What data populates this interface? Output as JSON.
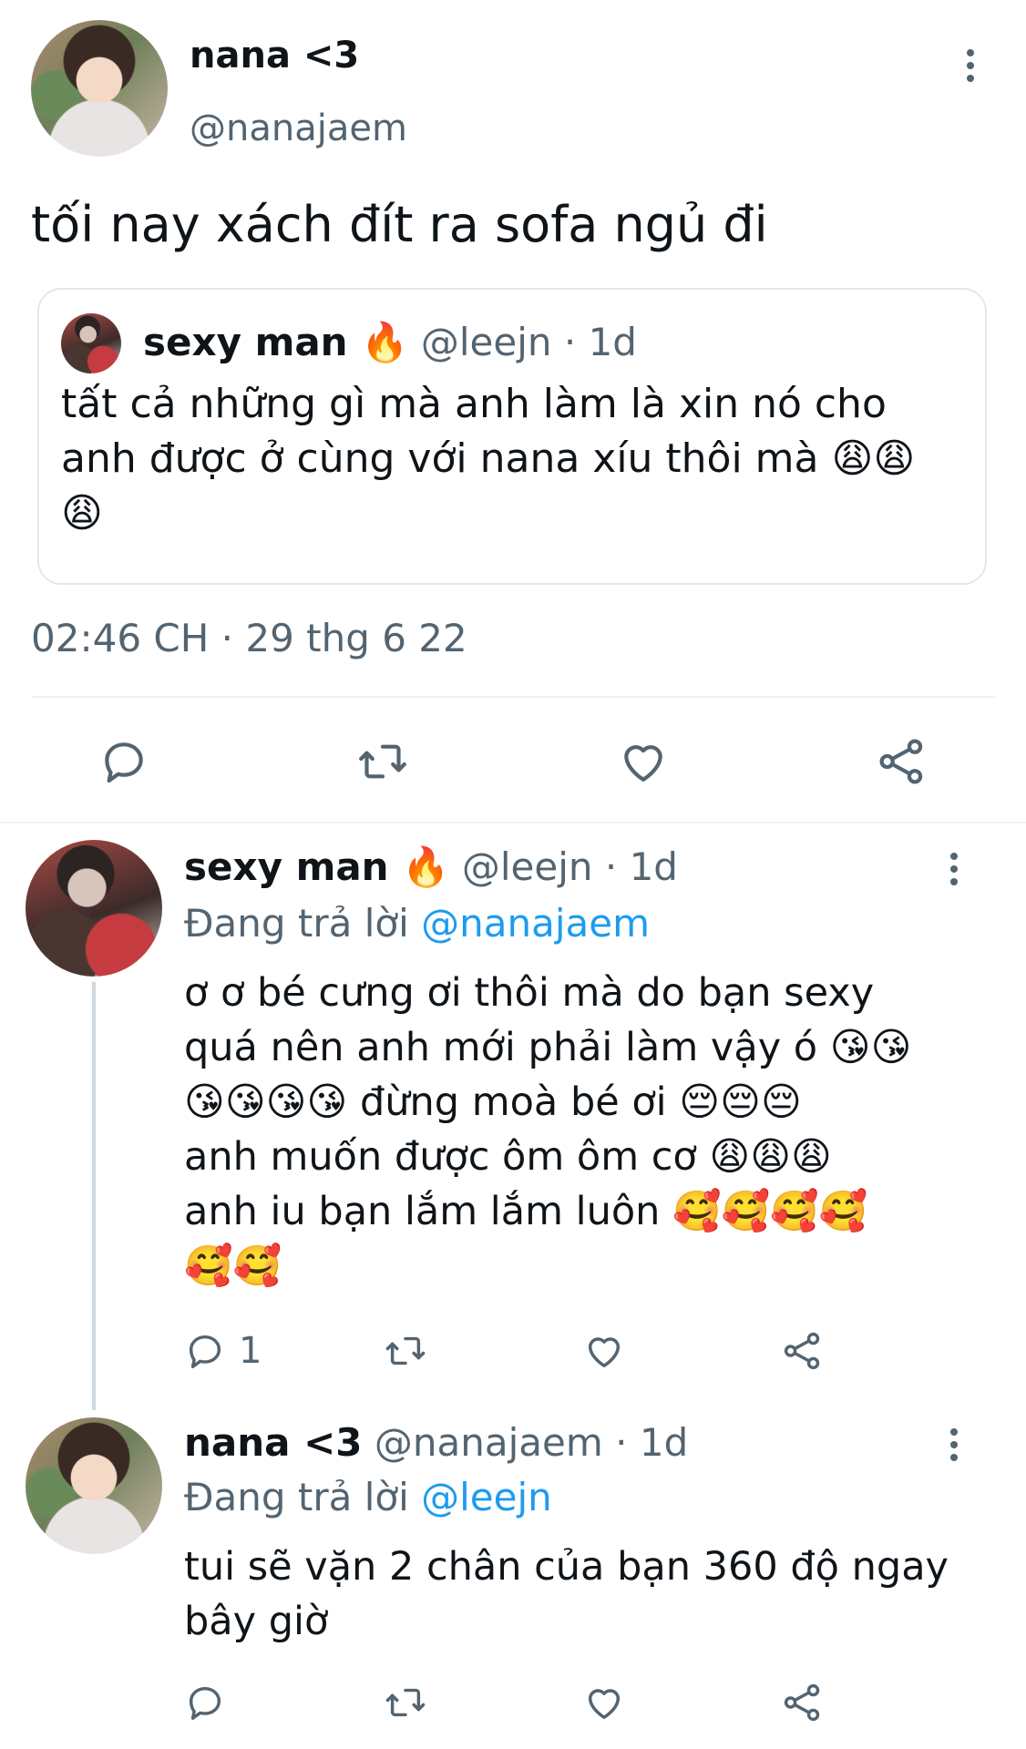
{
  "main_tweet": {
    "display_name": "nana <3",
    "handle": "@nanajaem",
    "text": "tối nay xách đít ra sofa ngủ đi",
    "timestamp": "02:46 CH · 29 thg 6 22",
    "quoted": {
      "display_name": "sexy man 🔥",
      "handle": "@leejn",
      "dot": "·",
      "time": "1d",
      "text_line1": "tất cả những gì mà anh làm là xin nó cho",
      "text_line2": "anh được ở cùng với nana xíu thôi mà 😩😩",
      "text_line3": "😩"
    }
  },
  "reply1": {
    "display_name": "sexy man 🔥",
    "handle": "@leejn",
    "dot": "·",
    "time": "1d",
    "replying_prefix": "Đang trả lời",
    "replying_to": "@nanajaem",
    "lines": [
      "ơ ơ bé cưng ơi thôi mà do bạn sexy",
      "quá nên anh mới phải làm vậy ó 😘😘",
      "😘😘😘😘 đừng moà bé ơi 😔😔😔",
      "anh muốn được ôm ôm cơ 😩😩😩",
      "anh iu bạn lắm lắm luôn 🥰🥰🥰🥰",
      "🥰🥰"
    ],
    "reply_count": "1"
  },
  "reply2": {
    "display_name": "nana <3",
    "handle": "@nanajaem",
    "dot": "·",
    "time": "1d",
    "replying_prefix": "Đang trả lời",
    "replying_to": "@leejn",
    "lines": [
      "tui sẽ vặn 2 chân của bạn 360 độ ngay",
      "bây giờ"
    ]
  },
  "icons": {
    "reply": "reply-icon",
    "retweet": "retweet-icon",
    "like": "heart-icon",
    "share": "share-icon",
    "more": "more-options-icon"
  },
  "colors": {
    "text": "#0f1419",
    "muted": "#536471",
    "link": "#1d9bf0",
    "divider": "#eff3f4"
  }
}
